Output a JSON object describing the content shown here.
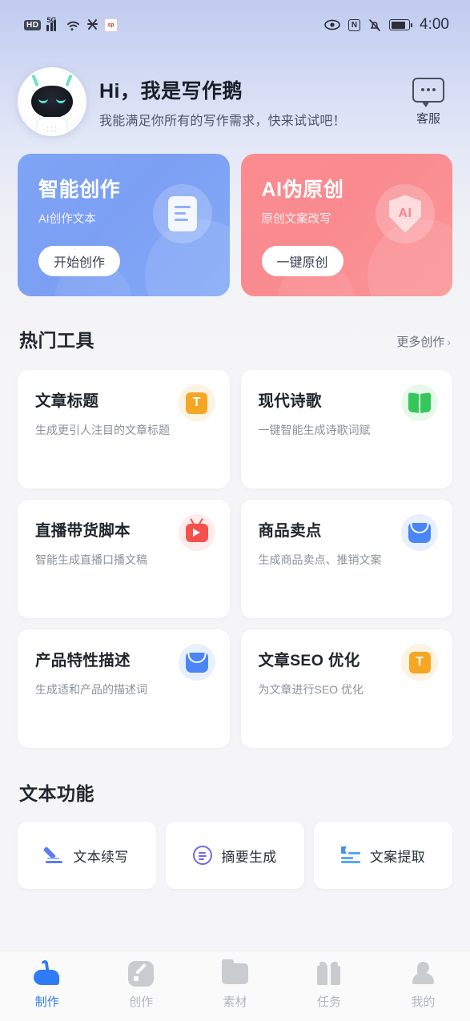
{
  "status_bar": {
    "hd_label": "HD",
    "network": "5G",
    "wifi_icon": "wifi-icon",
    "vpn_icon": "vpn-icon",
    "app_badge_icon": "sporl-app-icon",
    "eye_icon": "eye-comfort-icon",
    "nfc_label": "N",
    "mute_icon": "mute-bell-icon",
    "battery_icon": "battery-icon",
    "time": "4:00"
  },
  "greeting": {
    "mascot_icon": "robot-mascot-avatar",
    "title": "Hi，我是写作鹅",
    "subtitle": "我能满足你所有的写作需求，快来试试吧！",
    "customer_service": {
      "icon": "chat-bubble-icon",
      "label": "客服"
    }
  },
  "banners": [
    {
      "title": "智能创作",
      "subtitle": "AI创作文本",
      "button": "开始创作",
      "icon": "document-lines-icon",
      "color": "#7c9ff4"
    },
    {
      "title": "AI伪原创",
      "subtitle": "原创文案改写",
      "button": "一键原创",
      "icon": "shield-ai-icon",
      "icon_text": "AI",
      "color": "#f98b90"
    }
  ],
  "hot_tools": {
    "title": "热门工具",
    "more_label": "更多创作",
    "more_chevron": "chevron-right-icon",
    "items": [
      {
        "title": "文章标题",
        "desc": "生成更引人注目的文章标题",
        "icon": "orange-t-square-icon",
        "icon_text": "T",
        "icon_color": "#f5a623",
        "icon_bg": "#fdf3e3"
      },
      {
        "title": "现代诗歌",
        "desc": "一键智能生成诗歌词赋",
        "icon": "green-book-icon",
        "icon_color": "#35c759",
        "icon_bg": "#e8f9ec"
      },
      {
        "title": "直播带货脚本",
        "desc": "智能生成直播口播文稿",
        "icon": "red-tv-play-icon",
        "icon_color": "#f4514e",
        "icon_bg": "#fdeceb"
      },
      {
        "title": "商品卖点",
        "desc": "生成商品卖点、推销文案",
        "icon": "blue-shopping-bag-icon",
        "icon_color": "#4a86f7",
        "icon_bg": "#e8f0fe"
      },
      {
        "title": "产品特性描述",
        "desc": "生成适和产品的描述词",
        "icon": "blue-shopping-bag-icon",
        "icon_color": "#4a86f7",
        "icon_bg": "#e8f0fe"
      },
      {
        "title": "文章SEO 优化",
        "desc": "为文章进行SEO 优化",
        "icon": "orange-t-square-icon",
        "icon_text": "T",
        "icon_color": "#f5a623",
        "icon_bg": "#fdf3e3"
      }
    ]
  },
  "text_functions": {
    "title": "文本功能",
    "items": [
      {
        "label": "文本续写",
        "icon": "pencil-underline-icon"
      },
      {
        "label": "摘要生成",
        "icon": "circle-lines-icon"
      },
      {
        "label": "文案提取",
        "icon": "list-extract-icon"
      }
    ]
  },
  "bottom_nav": {
    "active_color": "#2f7cf6",
    "inactive_color": "#b2b6bd",
    "items": [
      {
        "label": "制作",
        "icon": "swan-icon",
        "active": true
      },
      {
        "label": "创作",
        "icon": "pencil-square-icon",
        "active": false
      },
      {
        "label": "素材",
        "icon": "folder-icon",
        "active": false
      },
      {
        "label": "任务",
        "icon": "gift-icon",
        "active": false
      },
      {
        "label": "我的",
        "icon": "user-icon",
        "active": false
      }
    ]
  }
}
